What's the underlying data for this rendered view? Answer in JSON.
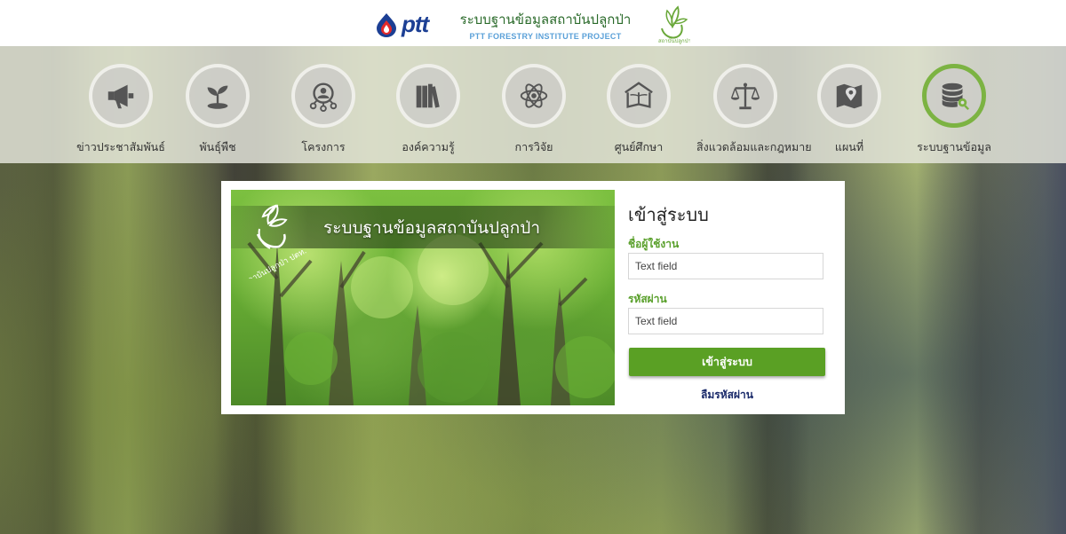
{
  "header": {
    "brand": "ptt",
    "title_th": "ระบบฐานข้อมูลสถาบันปลูกป่า",
    "title_en": "PTT FORESTRY INSTITUTE PROJECT",
    "logo_right_icon": "forestry-institute-emblem"
  },
  "nav": {
    "items": [
      {
        "label": "ข่าวประชาสัมพันธ์",
        "icon": "megaphone-icon"
      },
      {
        "label": "พันธุ์พืช",
        "icon": "sprout-icon"
      },
      {
        "label": "โครงการ",
        "icon": "people-network-icon"
      },
      {
        "label": "องค์ความรู้",
        "icon": "books-icon"
      },
      {
        "label": "การวิจัย",
        "icon": "atom-icon"
      },
      {
        "label": "ศูนย์ศึกษา",
        "icon": "open-book-house-icon"
      },
      {
        "label": "สิ่งแวดล้อมและกฎหมาย",
        "icon": "scales-icon"
      },
      {
        "label": "แผนที่",
        "icon": "map-pin-icon"
      },
      {
        "label": "ระบบฐานข้อมูล",
        "icon": "database-search-icon",
        "active": true
      }
    ]
  },
  "panel": {
    "image_title": "ระบบฐานข้อมูลสถาบันปลูกป่า",
    "emblem_text": "สถาบันปลูกป่า ปตท.",
    "login_title": "เข้าสู่ระบบ",
    "username_label": "ชื่อผู้ใช้งาน",
    "username_placeholder": "Text field",
    "password_label": "รหัสผ่าน",
    "password_placeholder": "Text field",
    "login_button": "เข้าสู่ระบบ",
    "forgot_link": "ลืมรหัสผ่าน"
  },
  "colors": {
    "accent_green": "#5aa024",
    "label_green": "#5aa02c",
    "link_navy": "#1a2a6a",
    "active_ring": "#7cb342"
  }
}
